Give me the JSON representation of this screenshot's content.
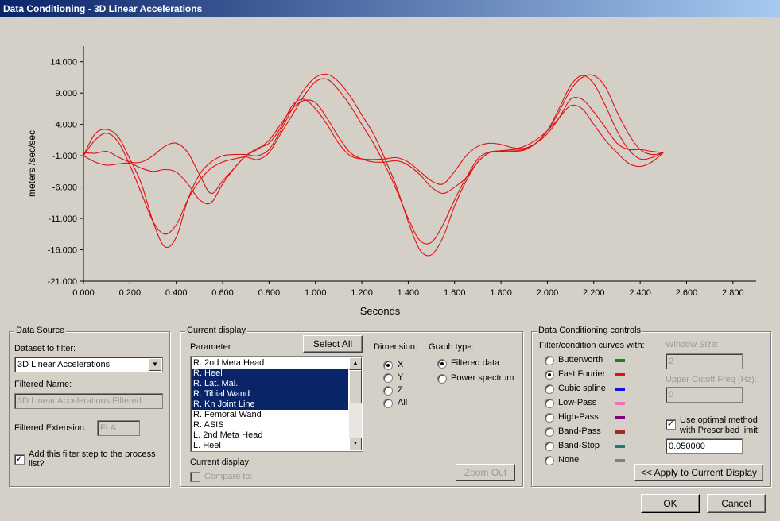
{
  "window": {
    "title": "Data Conditioning - 3D Linear Accelerations"
  },
  "chart_data": {
    "type": "line",
    "title": "",
    "xlabel": "Seconds",
    "ylabel": "meters /sec/sec",
    "xlim": [
      0,
      2.9
    ],
    "ylim": [
      -21,
      16.5
    ],
    "xticks": [
      "0.000",
      "0.200",
      "0.400",
      "0.600",
      "0.800",
      "1.000",
      "1.200",
      "1.400",
      "1.600",
      "1.800",
      "2.000",
      "2.200",
      "2.400",
      "2.600",
      "2.800"
    ],
    "yticks": [
      "-21.000",
      "-16.000",
      "-11.000",
      "-6.000",
      "-1.000",
      "4.000",
      "9.000",
      "14.000"
    ],
    "grid": false,
    "line_color": "#e01010",
    "series": [
      {
        "x": [
          0,
          0.05,
          0.1,
          0.15,
          0.2,
          0.25,
          0.3,
          0.35,
          0.4,
          0.45,
          0.5,
          0.55,
          0.6,
          0.65,
          0.7,
          0.75,
          0.8,
          0.85,
          0.9,
          0.95,
          1.0,
          1.05,
          1.1,
          1.15,
          1.2,
          1.25,
          1.3,
          1.35,
          1.4,
          1.45,
          1.5,
          1.55,
          1.6,
          1.65,
          1.7,
          1.75,
          1.8,
          1.85,
          1.9,
          1.95,
          2.0,
          2.05,
          2.1,
          2.15,
          2.2,
          2.25,
          2.3,
          2.35,
          2.4,
          2.45,
          2.5
        ],
        "y": [
          -1,
          1.5,
          2.6,
          1.2,
          -2.5,
          -7,
          -11.5,
          -13.5,
          -12,
          -8,
          -5,
          -3,
          -2,
          -1.5,
          -1.2,
          -1.6,
          -0.5,
          2.5,
          5.5,
          8.5,
          10.8,
          11.2,
          9.5,
          7,
          4,
          1,
          -2.5,
          -6.5,
          -11,
          -14.5,
          -14.8,
          -12,
          -8,
          -4.5,
          -1.5,
          -0.4,
          -0.3,
          -0.3,
          -0.1,
          1,
          3,
          6.5,
          10.2,
          11.8,
          10.5,
          7,
          3,
          0,
          -1.5,
          -1.3,
          -0.5
        ]
      },
      {
        "x": [
          0,
          0.05,
          0.1,
          0.15,
          0.2,
          0.25,
          0.3,
          0.35,
          0.4,
          0.45,
          0.5,
          0.55,
          0.6,
          0.65,
          0.7,
          0.75,
          0.8,
          0.85,
          0.9,
          0.95,
          1.0,
          1.05,
          1.1,
          1.15,
          1.2,
          1.25,
          1.3,
          1.35,
          1.4,
          1.45,
          1.5,
          1.55,
          1.6,
          1.65,
          1.7,
          1.75,
          1.8,
          1.85,
          1.9,
          1.95,
          2.0,
          2.05,
          2.1,
          2.15,
          2.2,
          2.25,
          2.3,
          2.35,
          2.4,
          2.45,
          2.5
        ],
        "y": [
          -1,
          2.5,
          3.2,
          2,
          -1.5,
          -5.5,
          -11.5,
          -15.5,
          -14,
          -8,
          -4,
          -2,
          -1,
          -0.8,
          -0.8,
          -1,
          0,
          3,
          6.5,
          9.5,
          11.5,
          12,
          10.8,
          8.5,
          5.5,
          2.5,
          -1.5,
          -6,
          -11.5,
          -16,
          -16.8,
          -14,
          -9,
          -5,
          -2,
          -0.5,
          -0.2,
          -0.1,
          0,
          1,
          3,
          6,
          9.5,
          11.5,
          11.8,
          10,
          6,
          2.5,
          0,
          -0.8,
          -0.5
        ]
      },
      {
        "x": [
          0,
          0.05,
          0.1,
          0.15,
          0.2,
          0.25,
          0.3,
          0.35,
          0.4,
          0.45,
          0.5,
          0.55,
          0.6,
          0.65,
          0.7,
          0.75,
          0.8,
          0.85,
          0.9,
          0.95,
          1.0,
          1.05,
          1.1,
          1.15,
          1.2,
          1.25,
          1.3,
          1.35,
          1.4,
          1.45,
          1.5,
          1.55,
          1.6,
          1.65,
          1.7,
          1.75,
          1.8,
          1.85,
          1.9,
          1.95,
          2.0,
          2.05,
          2.1,
          2.15,
          2.2,
          2.25,
          2.3,
          2.35,
          2.4,
          2.45,
          2.5
        ],
        "y": [
          -1,
          -2,
          -2.5,
          -2.3,
          -2.2,
          -3,
          -3.5,
          -3.2,
          -3.6,
          -5.5,
          -8,
          -8.5,
          -5.5,
          -3,
          -1,
          0,
          1.5,
          4,
          6.5,
          7.8,
          7.5,
          5,
          2,
          -0.5,
          -1.5,
          -2,
          -2,
          -1.8,
          -2.5,
          -4,
          -6,
          -7,
          -6,
          -4.5,
          -2,
          -0.5,
          -0.2,
          0,
          0.5,
          1.5,
          3,
          5,
          7,
          6.5,
          4,
          1.5,
          -0.5,
          -2.2,
          -2.7,
          -2,
          -0.5
        ]
      },
      {
        "x": [
          0,
          0.05,
          0.1,
          0.15,
          0.2,
          0.25,
          0.3,
          0.35,
          0.4,
          0.45,
          0.5,
          0.55,
          0.6,
          0.65,
          0.7,
          0.75,
          0.8,
          0.85,
          0.9,
          0.95,
          1.0,
          1.05,
          1.1,
          1.15,
          1.2,
          1.25,
          1.3,
          1.35,
          1.4,
          1.45,
          1.5,
          1.55,
          1.6,
          1.65,
          1.7,
          1.75,
          1.8,
          1.85,
          1.9,
          1.95,
          2.0,
          2.05,
          2.1,
          2.15,
          2.2,
          2.25,
          2.3,
          2.35,
          2.4,
          2.45,
          2.5
        ],
        "y": [
          -0.5,
          -0.6,
          -0.3,
          -1.2,
          -2,
          -2,
          -1,
          0.5,
          1,
          -0.5,
          -4,
          -7,
          -5,
          -3,
          -1,
          0.2,
          1,
          3.5,
          7,
          8,
          6.5,
          4,
          1,
          -1,
          -1.5,
          -1.6,
          -1.5,
          -1.3,
          -2,
          -3.5,
          -5,
          -5.5,
          -3.5,
          -1,
          0.5,
          1,
          0.8,
          0.3,
          0.2,
          1,
          2.5,
          5,
          8,
          8,
          6,
          3.5,
          1,
          0,
          0,
          -0.3,
          -0.5
        ]
      }
    ]
  },
  "data_source": {
    "legend": "Data Source",
    "dataset_label": "Dataset to filter:",
    "dataset_value": "3D Linear Accelerations",
    "filtered_name_label": "Filtered Name:",
    "filtered_name_value": "3D Linear Accelerations Filtered",
    "filtered_ext_label": "Filtered Extension:",
    "filtered_ext_value": "FLA",
    "add_filter_checked": "✓",
    "add_filter_label_line1": "Add this filter step to the process",
    "add_filter_label_line2": "list?"
  },
  "current_display": {
    "legend": "Current display",
    "parameter_label": "Parameter:",
    "select_all": "Select All",
    "parameters": [
      {
        "label": "R. 2nd Meta Head"
      },
      {
        "label": "R. Heel"
      },
      {
        "label": "R. Lat. Mal."
      },
      {
        "label": "R. Tibial Wand"
      },
      {
        "label": "R. Kn Joint Line"
      },
      {
        "label": "R. Femoral Wand"
      },
      {
        "label": "R. ASIS"
      },
      {
        "label": "L. 2nd Meta Head"
      },
      {
        "label": "L. Heel"
      }
    ],
    "selected_indices": [
      1,
      2,
      3,
      4
    ],
    "dimension_label": "Dimension:",
    "dimensions": [
      "X",
      "Y",
      "Z",
      "All"
    ],
    "dimension_selected": 0,
    "graph_type_label": "Graph type:",
    "graph_types": [
      "Filtered data",
      "Power spectrum"
    ],
    "graph_type_selected": 0,
    "current_display_label": "Current display:",
    "compare_label": "Compare to:",
    "zoom_out": "Zoom Out"
  },
  "conditioning": {
    "legend": "Data Conditioning controls",
    "curves_label": "Filter/condition curves with:",
    "filters": [
      {
        "label": "Butterworth",
        "color": "#0a8a10"
      },
      {
        "label": "Fast Fourier",
        "color": "#e01010"
      },
      {
        "label": "Cubic spline",
        "color": "#1010e0"
      },
      {
        "label": "Low-Pass",
        "color": "#f070c0"
      },
      {
        "label": "High-Pass",
        "color": "#800080"
      },
      {
        "label": "Band-Pass",
        "color": "#a02828"
      },
      {
        "label": "Band-Stop",
        "color": "#108080"
      },
      {
        "label": "None",
        "color": "#808080"
      }
    ],
    "filter_selected": 1,
    "window_size_label": "Window Size:",
    "window_size_value": "2",
    "cutoff_label": "Upper Cutoff Freq (Hz):",
    "cutoff_value": "0",
    "optimal_checked": "✓",
    "optimal_label_line1": "Use optimal method",
    "optimal_label_line2": "with Prescribed limit:",
    "limit_value": "0.050000",
    "apply_button": "<< Apply to Current Display"
  },
  "buttons": {
    "ok": "OK",
    "cancel": "Cancel"
  }
}
